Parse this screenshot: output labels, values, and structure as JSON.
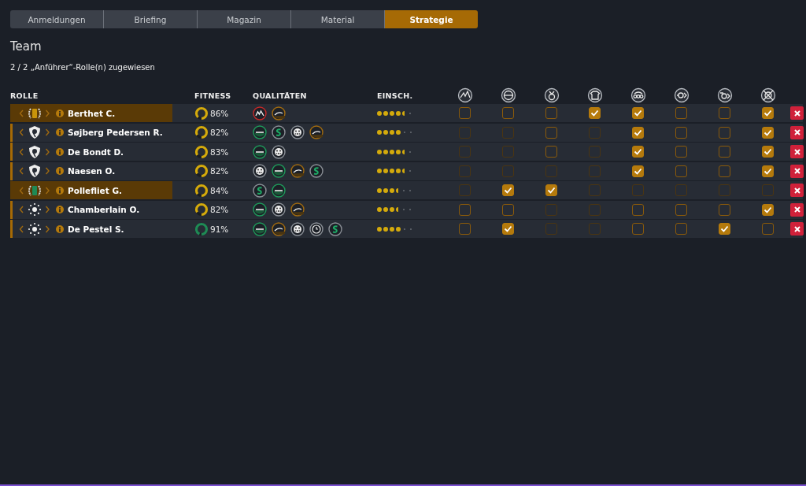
{
  "tabs": [
    {
      "label": "Anmeldungen",
      "selected": false
    },
    {
      "label": "Briefing",
      "selected": false
    },
    {
      "label": "Magazin",
      "selected": false
    },
    {
      "label": "Material",
      "selected": false
    },
    {
      "label": "Strategie",
      "selected": true
    }
  ],
  "title": "Team",
  "subtitle": "2 / 2 „Anführer“-Rolle(n) zugewiesen",
  "columns": {
    "role": "ROLLE",
    "fitness": "FITNESS",
    "qualities": "QUALITÄTEN",
    "rating": "EINSCH.",
    "tasks": [
      {
        "kind": "mountain"
      },
      {
        "kind": "minus"
      },
      {
        "kind": "medal"
      },
      {
        "kind": "jersey"
      },
      {
        "kind": "chain"
      },
      {
        "kind": "wheel"
      },
      {
        "kind": "wheel-plus"
      },
      {
        "kind": "crossed"
      }
    ]
  },
  "rows": [
    {
      "name": "Berthet C.",
      "role": {
        "kind": "laurel",
        "color": "#c8940a"
      },
      "highlighted": true,
      "fitness": {
        "level": 0.86,
        "reading": "86%",
        "color": "#d4aa0c"
      },
      "qualities": [
        {
          "kind": "hills"
        },
        {
          "kind": "hill"
        }
      ],
      "stars": 4,
      "half_star": true,
      "tasks": [
        {
          "checked": false,
          "disabled": false
        },
        {
          "checked": false,
          "disabled": false
        },
        {
          "checked": false,
          "disabled": false
        },
        {
          "checked": true,
          "disabled": false
        },
        {
          "checked": true,
          "disabled": false
        },
        {
          "checked": false,
          "disabled": false
        },
        {
          "checked": false,
          "disabled": false
        },
        {
          "checked": true,
          "disabled": false
        }
      ]
    },
    {
      "name": "Søjberg Pedersen R.",
      "role": {
        "kind": "shield"
      },
      "highlighted": false,
      "fitness": {
        "level": 0.82,
        "reading": "82%",
        "color": "#d4aa0c"
      },
      "qualities": [
        {
          "kind": "flat"
        },
        {
          "kind": "sprint"
        },
        {
          "kind": "cobbles"
        },
        {
          "kind": "hill"
        }
      ],
      "stars": 4,
      "half_star": false,
      "tasks": [
        {
          "checked": false,
          "disabled": true
        },
        {
          "checked": false,
          "disabled": true
        },
        {
          "checked": false,
          "disabled": false
        },
        {
          "checked": false,
          "disabled": true
        },
        {
          "checked": true,
          "disabled": false
        },
        {
          "checked": false,
          "disabled": false
        },
        {
          "checked": false,
          "disabled": false
        },
        {
          "checked": true,
          "disabled": false
        }
      ]
    },
    {
      "name": "De Bondt D.",
      "role": {
        "kind": "shield"
      },
      "highlighted": false,
      "fitness": {
        "level": 0.83,
        "reading": "83%",
        "color": "#d4aa0c"
      },
      "qualities": [
        {
          "kind": "flat"
        },
        {
          "kind": "cobbles"
        }
      ],
      "stars": 4,
      "half_star": true,
      "tasks": [
        {
          "checked": false,
          "disabled": true
        },
        {
          "checked": false,
          "disabled": true
        },
        {
          "checked": false,
          "disabled": false
        },
        {
          "checked": false,
          "disabled": true
        },
        {
          "checked": true,
          "disabled": false
        },
        {
          "checked": false,
          "disabled": false
        },
        {
          "checked": false,
          "disabled": false
        },
        {
          "checked": true,
          "disabled": false
        }
      ]
    },
    {
      "name": "Naesen O.",
      "role": {
        "kind": "shield"
      },
      "highlighted": false,
      "fitness": {
        "level": 0.82,
        "reading": "82%",
        "color": "#d4aa0c"
      },
      "qualities": [
        {
          "kind": "cobbles"
        },
        {
          "kind": "flat"
        },
        {
          "kind": "hill"
        },
        {
          "kind": "sprint"
        }
      ],
      "stars": 4,
      "half_star": true,
      "tasks": [
        {
          "checked": false,
          "disabled": true
        },
        {
          "checked": false,
          "disabled": true
        },
        {
          "checked": false,
          "disabled": true
        },
        {
          "checked": false,
          "disabled": true
        },
        {
          "checked": true,
          "disabled": false
        },
        {
          "checked": false,
          "disabled": false
        },
        {
          "checked": false,
          "disabled": false
        },
        {
          "checked": true,
          "disabled": false
        }
      ]
    },
    {
      "name": "Pollefliet G.",
      "role": {
        "kind": "laurel",
        "color": "#1f8a55"
      },
      "highlighted": true,
      "fitness": {
        "level": 0.84,
        "reading": "84%",
        "color": "#d4aa0c"
      },
      "qualities": [
        {
          "kind": "sprint"
        },
        {
          "kind": "flat"
        }
      ],
      "stars": 3,
      "half_star": true,
      "tasks": [
        {
          "checked": false,
          "disabled": true
        },
        {
          "checked": true,
          "disabled": false
        },
        {
          "checked": true,
          "disabled": false
        },
        {
          "checked": false,
          "disabled": true
        },
        {
          "checked": false,
          "disabled": true
        },
        {
          "checked": false,
          "disabled": true
        },
        {
          "checked": false,
          "disabled": true
        },
        {
          "checked": false,
          "disabled": true
        }
      ]
    },
    {
      "name": "Chamberlain O.",
      "role": {
        "kind": "sun"
      },
      "highlighted": false,
      "fitness": {
        "level": 0.82,
        "reading": "82%",
        "color": "#d4aa0c"
      },
      "qualities": [
        {
          "kind": "flat"
        },
        {
          "kind": "cobbles"
        },
        {
          "kind": "hill"
        }
      ],
      "stars": 3,
      "half_star": true,
      "tasks": [
        {
          "checked": false,
          "disabled": false
        },
        {
          "checked": false,
          "disabled": false
        },
        {
          "checked": false,
          "disabled": true
        },
        {
          "checked": false,
          "disabled": true
        },
        {
          "checked": false,
          "disabled": false
        },
        {
          "checked": false,
          "disabled": false
        },
        {
          "checked": false,
          "disabled": false
        },
        {
          "checked": true,
          "disabled": false
        }
      ]
    },
    {
      "name": "De Pestel S.",
      "role": {
        "kind": "sun"
      },
      "highlighted": false,
      "fitness": {
        "level": 0.91,
        "reading": "91%",
        "color": "#1f8a55"
      },
      "qualities": [
        {
          "kind": "flat"
        },
        {
          "kind": "hill"
        },
        {
          "kind": "cobbles"
        },
        {
          "kind": "clock"
        },
        {
          "kind": "sprint"
        }
      ],
      "stars": 4,
      "half_star": false,
      "tasks": [
        {
          "checked": false,
          "disabled": false
        },
        {
          "checked": true,
          "disabled": false
        },
        {
          "checked": false,
          "disabled": true
        },
        {
          "checked": false,
          "disabled": true
        },
        {
          "checked": false,
          "disabled": false
        },
        {
          "checked": false,
          "disabled": false
        },
        {
          "checked": true,
          "disabled": false
        },
        {
          "checked": false,
          "disabled": false
        }
      ]
    }
  ]
}
